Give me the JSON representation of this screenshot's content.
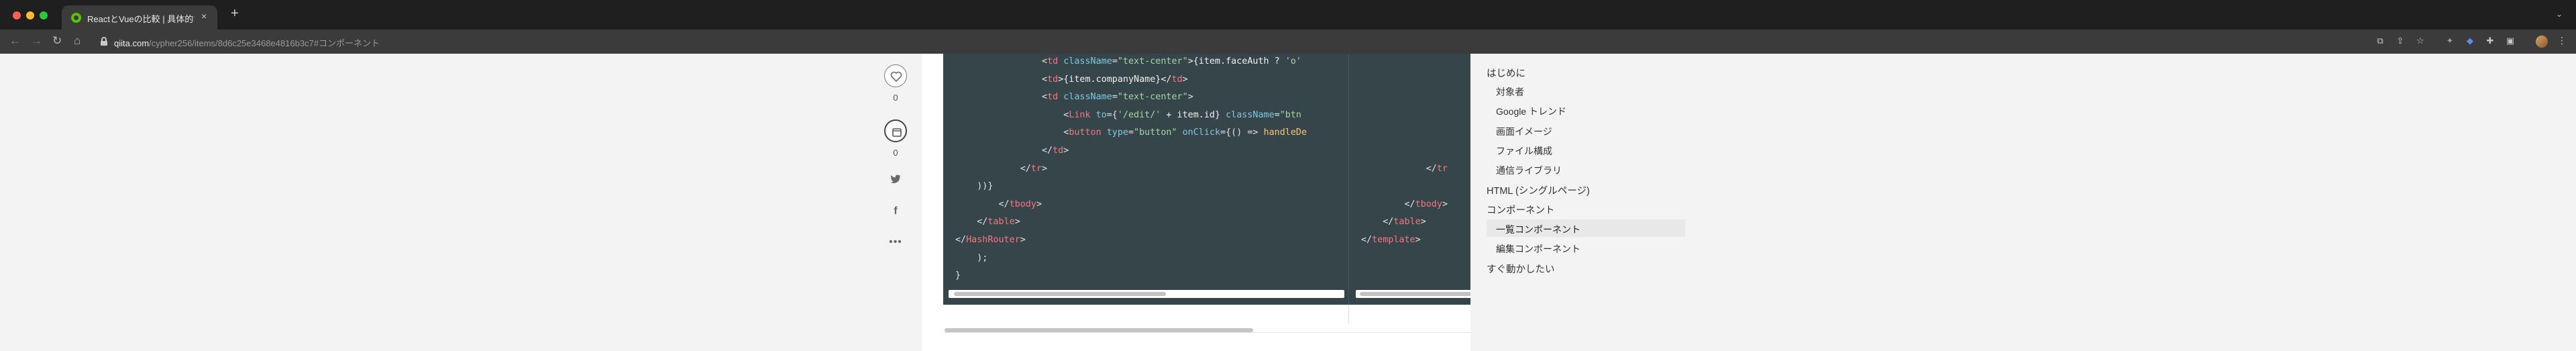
{
  "browser": {
    "tab_title": "ReactとVueの比較 | 具体的なコ…",
    "tab_close": "×",
    "new_tab": "+",
    "tab_menu": "⌄",
    "url_host": "qiita.com",
    "url_path": "/cypher256/items/8d6c25e3468e4816b3c7#コンポーネント",
    "nav": {
      "back": "←",
      "forward": "→",
      "reload": "↻",
      "home": "⌂"
    },
    "toolbar_icons": [
      "install-icon",
      "share-icon",
      "bookmark-star-icon",
      "extension-puzzle-icon",
      "shield-extension-icon",
      "extensions-icon",
      "sidebar-icon"
    ],
    "menu": "⋮"
  },
  "social": {
    "like_count": "0",
    "stock_count": "0"
  },
  "code": {
    "left_lines": [
      [
        {
          "t": "                <",
          "c": "c-brace"
        },
        {
          "t": "td",
          "c": "c-tag"
        },
        {
          "t": " className",
          "c": "c-attr"
        },
        {
          "t": "=",
          "c": "c-brace"
        },
        {
          "t": "\"text-center\"",
          "c": "c-str"
        },
        {
          "t": ">{item.faceAuth ? ",
          "c": "c-expr"
        },
        {
          "t": "'o'",
          "c": "c-str"
        }
      ],
      [
        {
          "t": "                <",
          "c": "c-brace"
        },
        {
          "t": "td",
          "c": "c-tag"
        },
        {
          "t": ">{item.companyName}</",
          "c": "c-expr"
        },
        {
          "t": "td",
          "c": "c-tag"
        },
        {
          "t": ">",
          "c": "c-brace"
        }
      ],
      [
        {
          "t": "                <",
          "c": "c-brace"
        },
        {
          "t": "td",
          "c": "c-tag"
        },
        {
          "t": " className",
          "c": "c-attr"
        },
        {
          "t": "=",
          "c": "c-brace"
        },
        {
          "t": "\"text-center\"",
          "c": "c-str"
        },
        {
          "t": ">",
          "c": "c-brace"
        }
      ],
      [
        {
          "t": "                    <",
          "c": "c-brace"
        },
        {
          "t": "Link",
          "c": "c-tag"
        },
        {
          "t": " to",
          "c": "c-attr"
        },
        {
          "t": "={",
          "c": "c-brace"
        },
        {
          "t": "'/edit/'",
          "c": "c-str"
        },
        {
          "t": " + item.id} ",
          "c": "c-expr"
        },
        {
          "t": "className",
          "c": "c-attr"
        },
        {
          "t": "=",
          "c": "c-brace"
        },
        {
          "t": "\"btn",
          "c": "c-str"
        }
      ],
      [
        {
          "t": "                    <",
          "c": "c-brace"
        },
        {
          "t": "button",
          "c": "c-tag"
        },
        {
          "t": " type",
          "c": "c-attr"
        },
        {
          "t": "=",
          "c": "c-brace"
        },
        {
          "t": "\"button\"",
          "c": "c-str"
        },
        {
          "t": " onClick",
          "c": "c-attr"
        },
        {
          "t": "={() => ",
          "c": "c-brace"
        },
        {
          "t": "handleDe",
          "c": "c-kw"
        }
      ],
      [
        {
          "t": "                </",
          "c": "c-brace"
        },
        {
          "t": "td",
          "c": "c-tag"
        },
        {
          "t": ">",
          "c": "c-brace"
        }
      ],
      [
        {
          "t": "            </",
          "c": "c-brace"
        },
        {
          "t": "tr",
          "c": "c-tag"
        },
        {
          "t": ">",
          "c": "c-brace"
        }
      ],
      [
        {
          "t": "    ))}",
          "c": "c-brace"
        }
      ],
      [
        {
          "t": "        </",
          "c": "c-brace"
        },
        {
          "t": "tbody",
          "c": "c-tag"
        },
        {
          "t": ">",
          "c": "c-brace"
        }
      ],
      [
        {
          "t": "    </",
          "c": "c-brace"
        },
        {
          "t": "table",
          "c": "c-tag"
        },
        {
          "t": ">",
          "c": "c-brace"
        }
      ],
      [
        {
          "t": "</",
          "c": "c-brace"
        },
        {
          "t": "HashRouter",
          "c": "c-tag"
        },
        {
          "t": ">",
          "c": "c-brace"
        }
      ],
      [
        {
          "t": "    );",
          "c": "c-brace"
        }
      ],
      [
        {
          "t": "}",
          "c": "c-brace"
        }
      ]
    ],
    "right_lines": [
      [],
      [],
      [],
      [],
      [],
      [],
      [
        {
          "t": "            </",
          "c": "c-brace"
        },
        {
          "t": "tr",
          "c": "c-tag"
        }
      ],
      [],
      [
        {
          "t": "        </",
          "c": "c-brace"
        },
        {
          "t": "tbody",
          "c": "c-tag"
        },
        {
          "t": ">",
          "c": "c-brace"
        }
      ],
      [
        {
          "t": "    </",
          "c": "c-brace"
        },
        {
          "t": "table",
          "c": "c-tag"
        },
        {
          "t": ">",
          "c": "c-brace"
        }
      ],
      [
        {
          "t": "</",
          "c": "c-brace"
        },
        {
          "t": "template",
          "c": "c-tag"
        },
        {
          "t": ">",
          "c": "c-brace"
        }
      ],
      [],
      []
    ]
  },
  "toc": {
    "items": [
      {
        "label": "はじめに",
        "level": 0,
        "active": false
      },
      {
        "label": "対象者",
        "level": 1,
        "active": false
      },
      {
        "label": "Google トレンド",
        "level": 1,
        "active": false
      },
      {
        "label": "画面イメージ",
        "level": 1,
        "active": false
      },
      {
        "label": "ファイル構成",
        "level": 1,
        "active": false
      },
      {
        "label": "通信ライブラリ",
        "level": 1,
        "active": false
      },
      {
        "label": "HTML (シングルページ)",
        "level": 0,
        "active": false
      },
      {
        "label": "コンポーネント",
        "level": 0,
        "active": false
      },
      {
        "label": "一覧コンポーネント",
        "level": 1,
        "active": true
      },
      {
        "label": "編集コンポーネント",
        "level": 1,
        "active": false
      },
      {
        "label": "すぐ動かしたい",
        "level": 0,
        "active": false
      }
    ]
  }
}
